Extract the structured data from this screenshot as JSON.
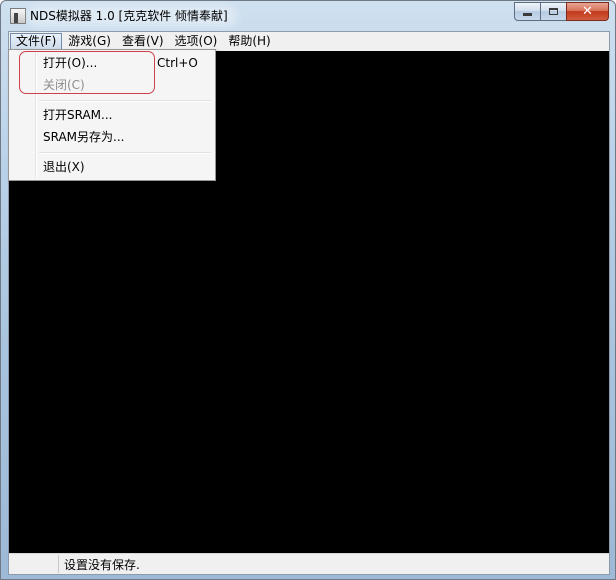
{
  "window": {
    "title": "NDS模拟器 1.0 [克克软件 倾情奉献]",
    "icon": "app-icon",
    "caption_buttons": [
      "minimize-icon",
      "maximize-icon",
      "close-icon"
    ],
    "close_glyph": "✕"
  },
  "menubar": {
    "items": [
      {
        "label": "文件(F)",
        "active": true
      },
      {
        "label": "游戏(G)"
      },
      {
        "label": "查看(V)"
      },
      {
        "label": "选项(O)"
      },
      {
        "label": "帮助(H)"
      }
    ]
  },
  "file_menu": {
    "items": [
      {
        "label": "打开(O)...",
        "shortcut": "Ctrl+O",
        "enabled": true
      },
      {
        "label": "关闭(C)",
        "shortcut": "",
        "enabled": false
      },
      {
        "label": "打开SRAM...",
        "shortcut": "",
        "enabled": true
      },
      {
        "label": "SRAM另存为...",
        "shortcut": "",
        "enabled": true
      },
      {
        "label": "退出(X)",
        "shortcut": "",
        "enabled": true
      }
    ]
  },
  "statusbar": {
    "text": "设置没有保存."
  },
  "colors": {
    "viewport_bg": "#000000",
    "annotation_box": "#d0404a",
    "disabled_text": "#8d8d8d"
  }
}
